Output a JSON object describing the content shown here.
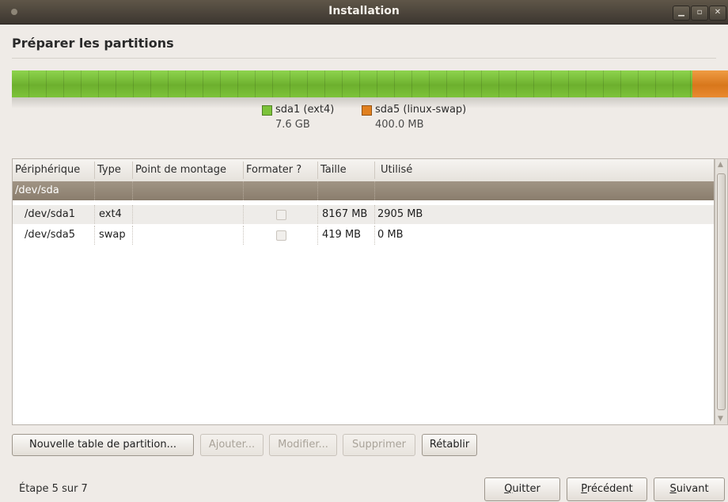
{
  "window": {
    "title": "Installation"
  },
  "page": {
    "title": "Préparer les partitions"
  },
  "partition_bar": {
    "segments": [
      {
        "name": "sda1 (ext4)",
        "size": "7.6 GB",
        "fraction": 0.95,
        "color": "#7cc33a"
      },
      {
        "name": "sda5 (linux-swap)",
        "size": "400.0 MB",
        "fraction": 0.05,
        "color": "#e1801f"
      }
    ]
  },
  "table": {
    "headers": {
      "device": "Périphérique",
      "type": "Type",
      "mount": "Point de montage",
      "format": "Formater ?",
      "size": "Taille",
      "used": "Utilisé"
    },
    "rows": [
      {
        "device": "/dev/sda",
        "type": "",
        "mount": "",
        "size": "",
        "used": "",
        "selected": true
      },
      {
        "device": "/dev/sda1",
        "type": "ext4",
        "mount": "",
        "size": "8167 MB",
        "used": "2905 MB",
        "format": false
      },
      {
        "device": "/dev/sda5",
        "type": "swap",
        "mount": "",
        "size": "419 MB",
        "used": "0 MB",
        "format": false
      }
    ]
  },
  "actions": {
    "new_table": "Nouvelle table de partition...",
    "add": "Ajouter...",
    "modify": "Modifier...",
    "delete": "Supprimer",
    "revert": "Rétablir"
  },
  "footer": {
    "step": "Étape 5 sur 7",
    "quit_ul": "Q",
    "quit_rest": "uitter",
    "back_ul": "P",
    "back_rest": "récédent",
    "next_ul": "S",
    "next_rest": "uivant"
  },
  "colors": {
    "selected_row": "#958979",
    "titlebar": "#4a433a"
  }
}
